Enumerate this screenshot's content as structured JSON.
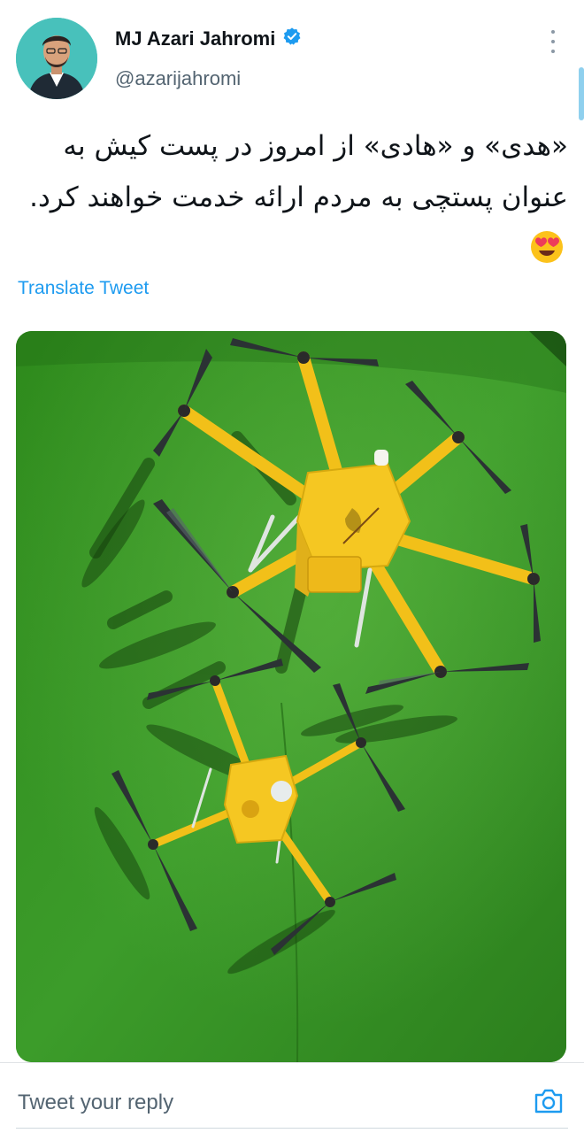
{
  "author": {
    "name": "MJ Azari Jahromi",
    "handle": "@azarijahromi",
    "verified": true
  },
  "tweet": {
    "text": "«هدی» و «هادی» از امروز در پست کیش به عنوان پستچی به مردم ارائه خدمت خواهند کرد.",
    "emoji": "smiling-face-with-heart-eyes"
  },
  "actions": {
    "translate_label": "Translate Tweet"
  },
  "reply": {
    "placeholder": "Tweet your reply"
  },
  "icons": {
    "more": "vertical-ellipsis-icon",
    "verified": "verified-badge-icon",
    "camera": "camera-icon"
  },
  "colors": {
    "accent": "#1d9bf0",
    "text": "#0f1419",
    "secondary": "#536471",
    "drone_yellow": "#f2c019",
    "grass": "#2f8a1e"
  }
}
